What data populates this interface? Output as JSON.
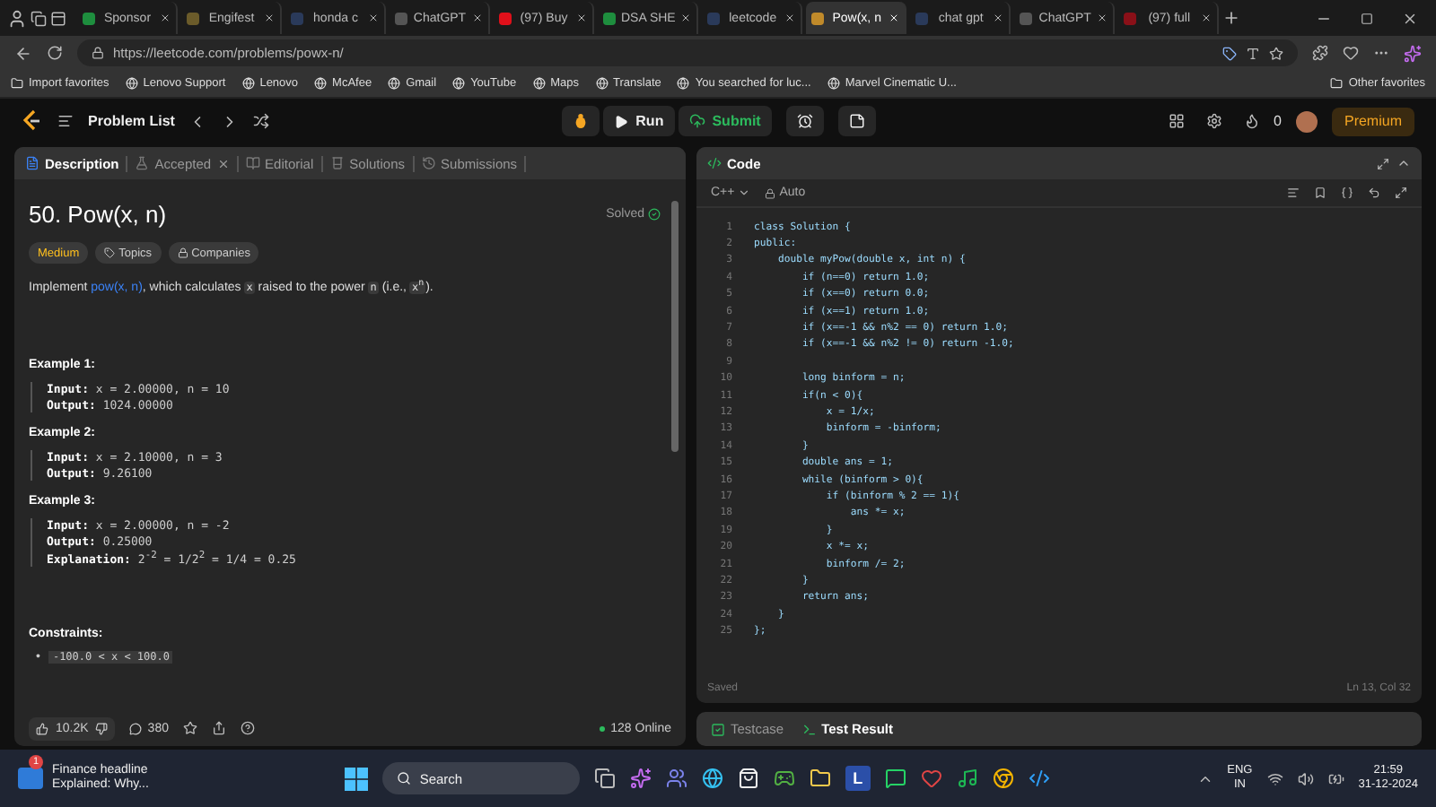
{
  "browser": {
    "tabs": [
      {
        "title": "Sponsor",
        "selected": false,
        "color": "#1e8e3e"
      },
      {
        "title": "Engifest",
        "selected": false,
        "color": "#6b5b2a"
      },
      {
        "title": "honda c",
        "selected": false,
        "color": "#2a3a5a"
      },
      {
        "title": "ChatGPT",
        "selected": false,
        "color": "#555555"
      },
      {
        "title": "(97) Buy",
        "selected": false,
        "color": "#e0101a"
      },
      {
        "title": "DSA SHE",
        "selected": false,
        "color": "#1e8e3e"
      },
      {
        "title": "leetcode",
        "selected": false,
        "color": "#2a3a5a"
      },
      {
        "title": "Pow(x, n",
        "selected": true,
        "color": "#c08a2a"
      },
      {
        "title": "chat gpt",
        "selected": false,
        "color": "#2a3a5a"
      },
      {
        "title": "ChatGPT",
        "selected": false,
        "color": "#555555"
      },
      {
        "title": "(97) full",
        "selected": false,
        "color": "#8a1018"
      }
    ],
    "url": "https://leetcode.com/problems/powx-n/",
    "bookmarks": [
      "Import favorites",
      "Lenovo Support",
      "Lenovo",
      "McAfee",
      "Gmail",
      "YouTube",
      "Maps",
      "Translate",
      "You searched for luc...",
      "Marvel Cinematic U..."
    ],
    "other_favorites": "Other favorites"
  },
  "header": {
    "problem_list": "Problem List",
    "run": "Run",
    "submit": "Submit",
    "streak": "0",
    "premium": "Premium"
  },
  "description_panel": {
    "tabs": [
      {
        "label": "Description",
        "selected": true
      },
      {
        "label": "Accepted",
        "selected": false
      },
      {
        "label": "Editorial",
        "selected": false
      },
      {
        "label": "Solutions",
        "selected": false
      },
      {
        "label": "Submissions",
        "selected": false
      }
    ],
    "title": "50. Pow(x, n)",
    "status": "Solved",
    "tags": [
      "Medium",
      "Topics",
      "Companies"
    ],
    "statement": [
      {
        "kind": "text",
        "text": "Implement "
      },
      {
        "kind": "link",
        "text": "pow(x, n)"
      },
      {
        "kind": "text",
        "text": ", which calculates "
      },
      {
        "kind": "code",
        "text": "x"
      },
      {
        "kind": "text",
        "text": " raised to the power "
      },
      {
        "kind": "code",
        "text": "n"
      },
      {
        "kind": "text",
        "text": " (i.e., "
      },
      {
        "kind": "code",
        "text": "x$^{n}$"
      },
      {
        "kind": "text",
        "text": ")."
      }
    ],
    "examples": [
      {
        "title": "Example 1:",
        "lines": [
          {
            "label": "Input:",
            "value": "x = 2.00000, n = 10"
          },
          {
            "label": "Output:",
            "value": "1024.00000"
          }
        ]
      },
      {
        "title": "Example 2:",
        "lines": [
          {
            "label": "Input:",
            "value": "x = 2.10000, n = 3"
          },
          {
            "label": "Output:",
            "value": "9.26100"
          }
        ]
      },
      {
        "title": "Example 3:",
        "lines": [
          {
            "label": "Input:",
            "value": "x = 2.00000, n = -2"
          },
          {
            "label": "Output:",
            "value": "0.25000"
          },
          {
            "label": "Explanation:",
            "value": "2$^{-2}$ = 1/2$^{2}$ = 1/4 = 0.25"
          }
        ]
      }
    ],
    "constraints_title": "Constraints:",
    "constraints": [
      {
        "bullet": "•",
        "text": "-100.0 < x < 100.0"
      }
    ],
    "likes": "10.2K",
    "comments": "380",
    "online": "128 Online"
  },
  "code_panel": {
    "title": "Code",
    "language": "C++",
    "mode": "Auto",
    "lines": [
      {
        "number": "1",
        "text": "class Solution {"
      },
      {
        "number": "2",
        "text": "public:"
      },
      {
        "number": "3",
        "text": "    double myPow(double x, int n) {"
      },
      {
        "number": "4",
        "text": "        if (n==0) return 1.0;"
      },
      {
        "number": "5",
        "text": "        if (x==0) return 0.0;"
      },
      {
        "number": "6",
        "text": "        if (x==1) return 1.0;"
      },
      {
        "number": "7",
        "text": "        if (x==-1 && n%2 == 0) return 1.0;"
      },
      {
        "number": "8",
        "text": "        if (x==-1 && n%2 != 0) return -1.0;"
      },
      {
        "number": "9"
      },
      {
        "number": "10",
        "text": "        long binform = n;"
      },
      {
        "number": "11",
        "text": "        if(n < 0){"
      },
      {
        "number": "12",
        "text": "            x = 1/x;"
      },
      {
        "number": "13",
        "text": "            binform = -binform;"
      },
      {
        "number": "14",
        "text": "        }"
      },
      {
        "number": "15",
        "text": "        double ans = 1;"
      },
      {
        "number": "16",
        "text": "        while (binform > 0){"
      },
      {
        "number": "17",
        "text": "            if (binform % 2 == 1){"
      },
      {
        "number": "18",
        "text": "                ans *= x;"
      },
      {
        "number": "19",
        "text": "            }"
      },
      {
        "number": "20",
        "text": "            x *= x;"
      },
      {
        "number": "21",
        "text": "            binform /= 2;"
      },
      {
        "number": "22",
        "text": "        }"
      },
      {
        "number": "23",
        "text": "        return ans;"
      },
      {
        "number": "24",
        "text": "    }"
      },
      {
        "number": "25",
        "text": "};"
      }
    ],
    "saved": "Saved",
    "cursor": "Ln 13, Col 32"
  },
  "result_panel": {
    "tabs": [
      {
        "label": "Testcase",
        "selected": false
      },
      {
        "label": "Test Result",
        "selected": true
      }
    ]
  },
  "taskbar": {
    "news_badge": "1",
    "news_title": "Finance headline",
    "news_text": "Explained: Why...",
    "search": "Search",
    "letter_tile": "L",
    "language": "ENG",
    "region": "IN",
    "time": "21:59",
    "date": "31-12-2024"
  }
}
